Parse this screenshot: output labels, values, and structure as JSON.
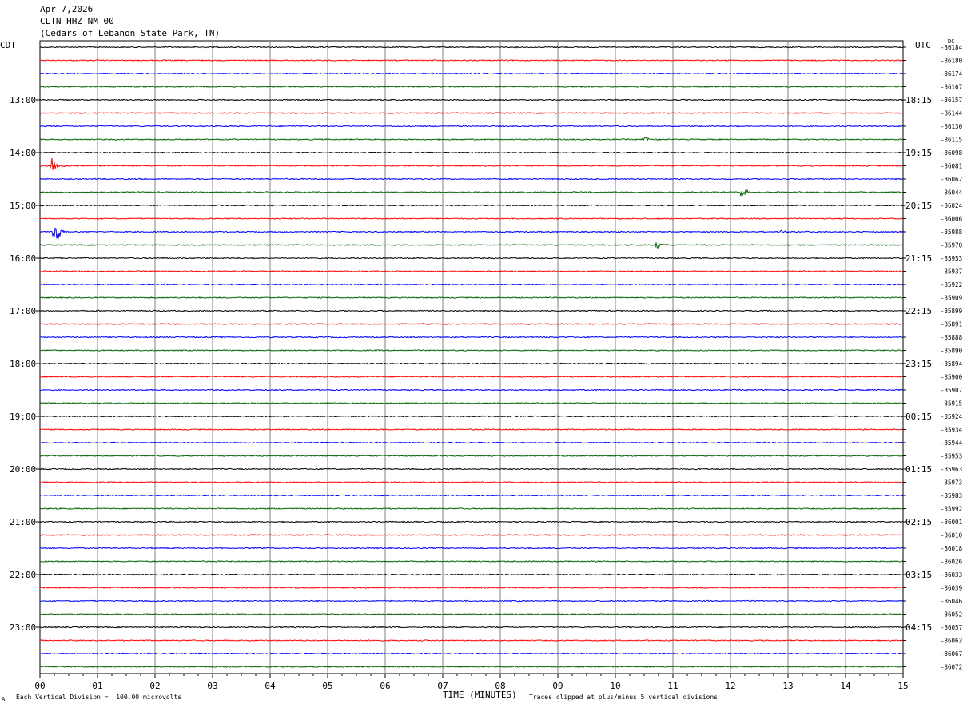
{
  "header": {
    "date": "Apr 7,2026",
    "station": "CLTN HHZ NM 00",
    "location": "(Cedars of Lebanon State Park, TN)"
  },
  "left_tz": "CDT",
  "right_tz": "UTC",
  "dc_label": "DC",
  "footer": {
    "scale": "Each Vertical Division =  100.00 microvolts",
    "clip": "Traces clipped at plus/minus 5 vertical divisions",
    "corner_mark": "A"
  },
  "colors": {
    "black": "#000000",
    "red": "#ff0000",
    "blue": "#0000ff",
    "green": "#006400",
    "grid": "#808080"
  },
  "chart_data": {
    "type": "line",
    "xlabel": "TIME (MINUTES)",
    "x_ticks": [
      "00",
      "01",
      "02",
      "03",
      "04",
      "05",
      "06",
      "07",
      "08",
      "09",
      "10",
      "11",
      "12",
      "13",
      "14",
      "15"
    ],
    "xlim": [
      0,
      15
    ],
    "left_hour_labels": [
      "13:00",
      "14:00",
      "15:00",
      "16:00",
      "17:00",
      "18:00",
      "19:00",
      "20:00",
      "21:00",
      "22:00",
      "23:00"
    ],
    "right_hour_labels": [
      "18:15",
      "19:15",
      "20:15",
      "21:15",
      "22:15",
      "23:15",
      "00:15",
      "01:15",
      "02:15",
      "03:15",
      "04:15"
    ],
    "trace_colors": [
      "black",
      "red",
      "blue",
      "green"
    ],
    "dc_offsets": [
      "-36184",
      "-36180",
      "-36174",
      "-36167",
      "-36157",
      "-36144",
      "-36130",
      "-36115",
      "-36098",
      "-36081",
      "-36062",
      "-36044",
      "-36024",
      "-36006",
      "-35988",
      "-35970",
      "-35953",
      "-35937",
      "-35922",
      "-35909",
      "-35899",
      "-35891",
      "-35888",
      "-35890",
      "-35894",
      "-35900",
      "-35907",
      "-35915",
      "-35924",
      "-35934",
      "-35944",
      "-35953",
      "-35963",
      "-35973",
      "-35983",
      "-35992",
      "-36001",
      "-36010",
      "-36018",
      "-36026",
      "-36033",
      "-36039",
      "-36046",
      "-36052",
      "-36057",
      "-36063",
      "-36067",
      "-36072"
    ],
    "events": [
      {
        "trace": 7,
        "minute": 10.5,
        "amplitude": 0.4
      },
      {
        "trace": 9,
        "minute": 0.2,
        "amplitude": 1.6
      },
      {
        "trace": 11,
        "minute": 12.2,
        "amplitude": 0.8
      },
      {
        "trace": 14,
        "minute": 0.25,
        "amplitude": 2.4
      },
      {
        "trace": 14,
        "minute": 12.9,
        "amplitude": 0.4
      },
      {
        "trace": 15,
        "minute": 10.7,
        "amplitude": 0.7
      }
    ]
  }
}
